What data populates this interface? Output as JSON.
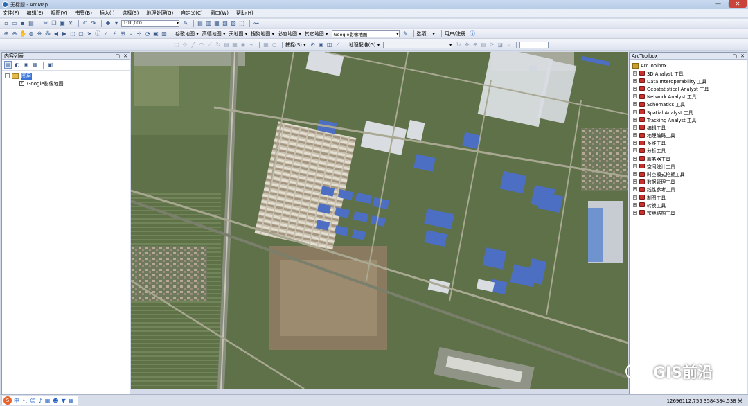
{
  "window": {
    "title": "无标题 - ArcMap",
    "controls": {
      "minimize": "—",
      "maximize": "□",
      "close": "✕"
    }
  },
  "menu": [
    "文件(F)",
    "编辑(E)",
    "视图(V)",
    "书签(B)",
    "插入(I)",
    "选择(S)",
    "地理处理(G)",
    "自定义(C)",
    "窗口(W)",
    "帮助(H)"
  ],
  "toolbar": {
    "scale": "1:10,000",
    "basemap_menus": [
      "谷歌地图 ▾",
      "高德地图 ▾",
      "天地图 ▾",
      "搜狗地图 ▾",
      "必应地图 ▾",
      "其它地图 ▾"
    ],
    "current_layer": "Google影像地图",
    "extra_labels": [
      "选项... ▾",
      "用户/注册"
    ],
    "snapping_label": "捕捉(S) ▾",
    "georef_label": "地理配准(G) ▾"
  },
  "toc": {
    "title": "内容列表",
    "root": "图层",
    "layers": [
      {
        "name": "Google影像地图",
        "checked": "✓"
      }
    ]
  },
  "toolbox": {
    "title": "ArcToolbox",
    "root": "ArcToolbox",
    "items": [
      "3D Analyst 工具",
      "Data Interoperability 工具",
      "Geostatistical Analyst 工具",
      "Network Analyst 工具",
      "Schematics 工具",
      "Spatial Analyst 工具",
      "Tracking Analyst 工具",
      "编辑工具",
      "地理编码工具",
      "多维工具",
      "分析工具",
      "服务器工具",
      "空间统计工具",
      "时空模式挖掘工具",
      "数据管理工具",
      "线性参考工具",
      "制图工具",
      "转换工具",
      "宗地结构工具"
    ]
  },
  "status": {
    "coordinates": "12696112.755  3584384.538 米"
  },
  "watermark": {
    "text": "GIS前沿"
  },
  "ime": {
    "lang": "中"
  },
  "colors": {
    "accent": "#3874d8",
    "toolbox_icon": "#c8322c",
    "close_button": "#c9453b"
  }
}
